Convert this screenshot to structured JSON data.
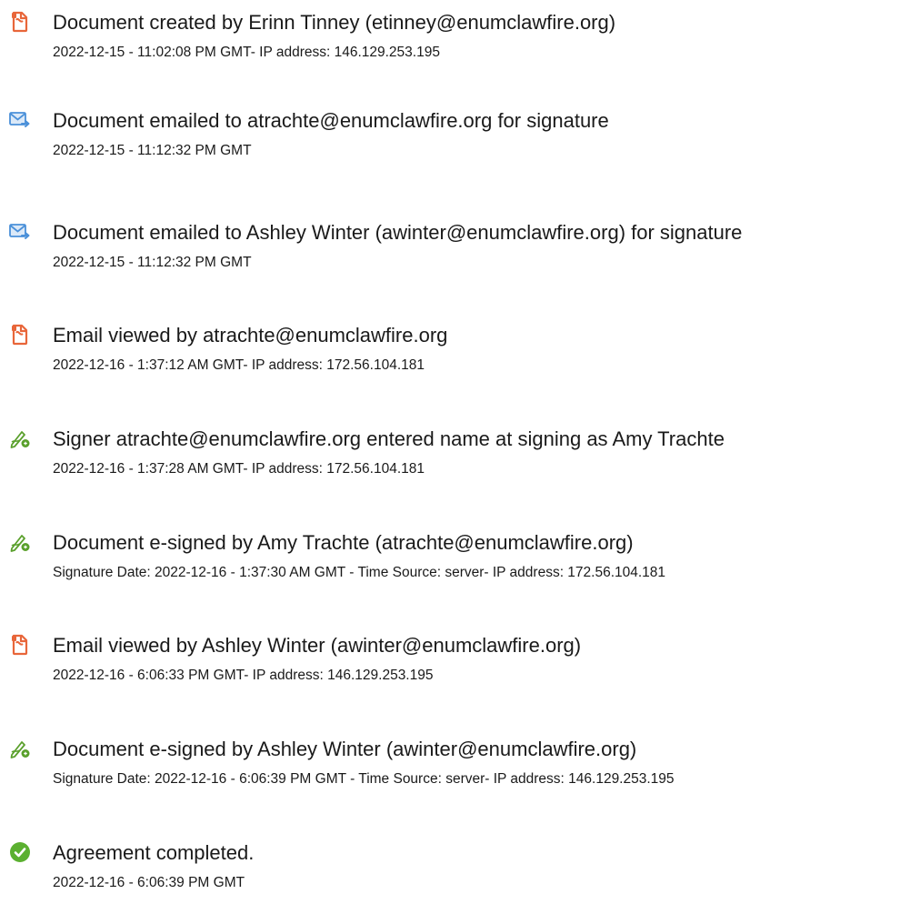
{
  "events": [
    {
      "icon": "document-created-icon",
      "title": "Document created by Erinn Tinney (etinney@enumclawfire.org)",
      "detail": "2022-12-15 - 11:02:08 PM GMT- IP address: 146.129.253.195"
    },
    {
      "icon": "email-sent-icon",
      "title": "Document emailed to atrachte@enumclawfire.org for signature",
      "detail": "2022-12-15 - 11:12:32 PM GMT"
    },
    {
      "icon": "email-sent-icon",
      "title": "Document emailed to Ashley Winter (awinter@enumclawfire.org) for signature",
      "detail": "2022-12-15 - 11:12:32 PM GMT"
    },
    {
      "icon": "document-viewed-icon",
      "title": "Email viewed by atrachte@enumclawfire.org",
      "detail": "2022-12-16 - 1:37:12 AM GMT- IP address: 172.56.104.181"
    },
    {
      "icon": "signature-pen-icon",
      "title": "Signer atrachte@enumclawfire.org entered name at signing as Amy Trachte",
      "detail": "2022-12-16 - 1:37:28 AM GMT- IP address: 172.56.104.181"
    },
    {
      "icon": "signature-pen-icon",
      "title": "Document e-signed by Amy Trachte (atrachte@enumclawfire.org)",
      "detail": "Signature Date: 2022-12-16 - 1:37:30 AM GMT - Time Source: server- IP address: 172.56.104.181"
    },
    {
      "icon": "document-viewed-icon",
      "title": "Email viewed by Ashley Winter (awinter@enumclawfire.org)",
      "detail": "2022-12-16 - 6:06:33 PM GMT- IP address: 146.129.253.195"
    },
    {
      "icon": "signature-pen-icon",
      "title": "Document e-signed by Ashley Winter (awinter@enumclawfire.org)",
      "detail": "Signature Date: 2022-12-16 - 6:06:39 PM GMT - Time Source: server- IP address: 146.129.253.195"
    },
    {
      "icon": "check-circle-icon",
      "title": "Agreement completed.",
      "detail": "2022-12-16 - 6:06:39 PM GMT"
    }
  ],
  "colors": {
    "doc_orange": "#e8663a",
    "email_blue": "#4a90d9",
    "pen_green": "#5aa02c",
    "check_green": "#5bb030",
    "text": "#1a1a1a"
  }
}
